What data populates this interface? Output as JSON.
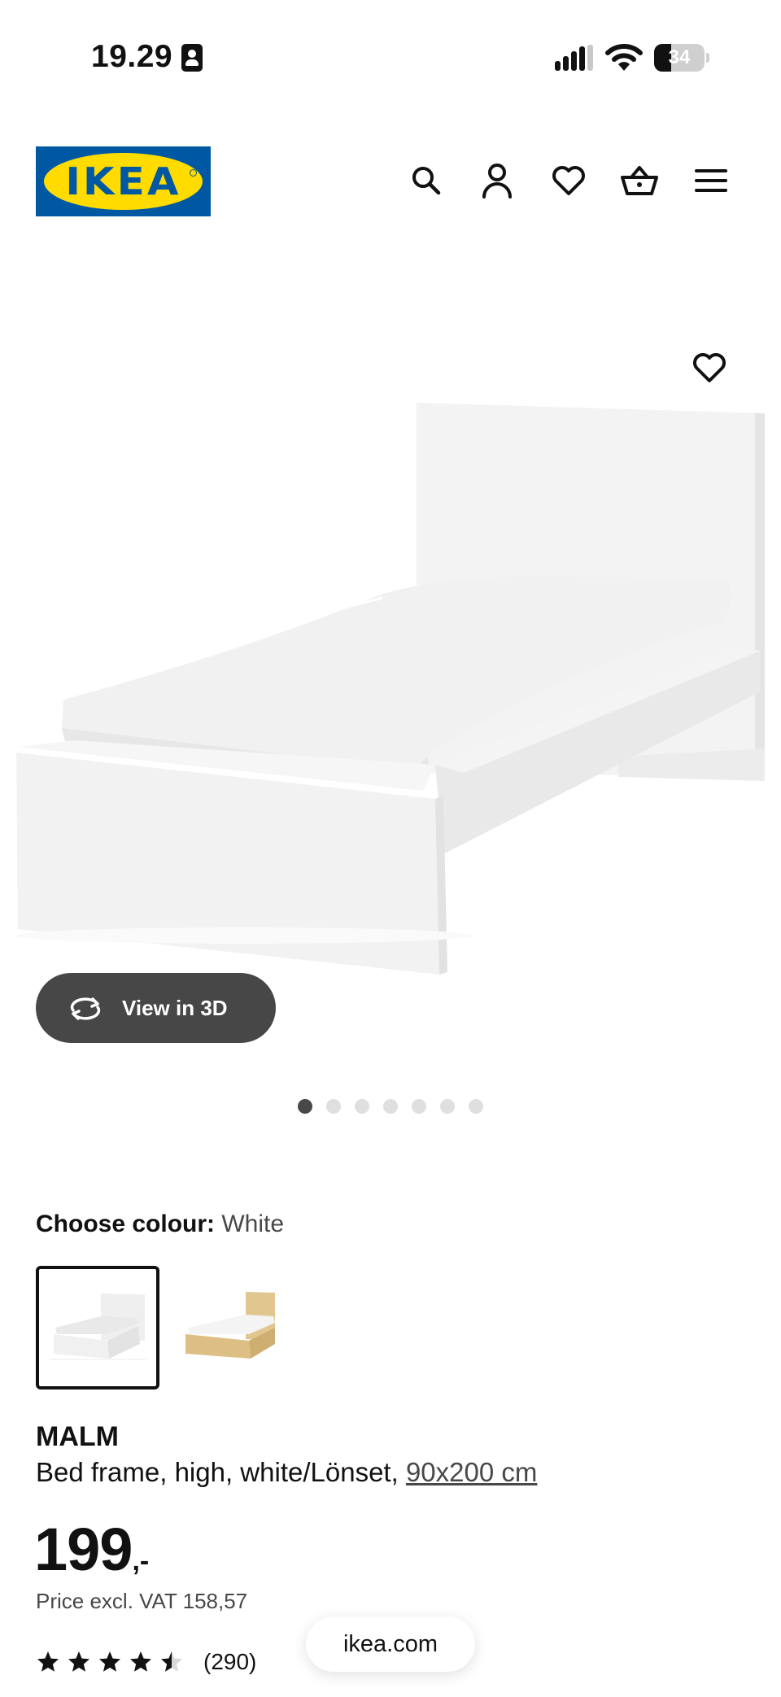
{
  "status_bar": {
    "time": "19.29",
    "battery": "34",
    "battery_level": 0.34
  },
  "header": {
    "logo_text": "IKEA",
    "icons": [
      "search-icon",
      "account-icon",
      "heart-icon",
      "basket-icon",
      "menu-icon"
    ]
  },
  "gallery": {
    "view_3d_label": "View in 3D",
    "image_count": 7,
    "active_index": 0
  },
  "colour": {
    "label": "Choose colour:",
    "value": "White",
    "options": [
      "White",
      "Oak"
    ]
  },
  "product": {
    "name": "MALM",
    "description": "Bed frame, high, white/Lönset,",
    "size": "90x200 cm",
    "price_int": "199",
    "price_dec": ",-",
    "vat_text": "Price excl. VAT 158,57",
    "rating_value": 4.5,
    "rating_max": 5,
    "rating_count": "(290)"
  },
  "browser": {
    "url": "ikea.com"
  },
  "colors": {
    "ikea_blue": "#0058A3",
    "ikea_yellow": "#FFDB00",
    "button_dark": "#474747",
    "dot_active": "#484848",
    "dot_inactive": "#dfdfdf"
  }
}
